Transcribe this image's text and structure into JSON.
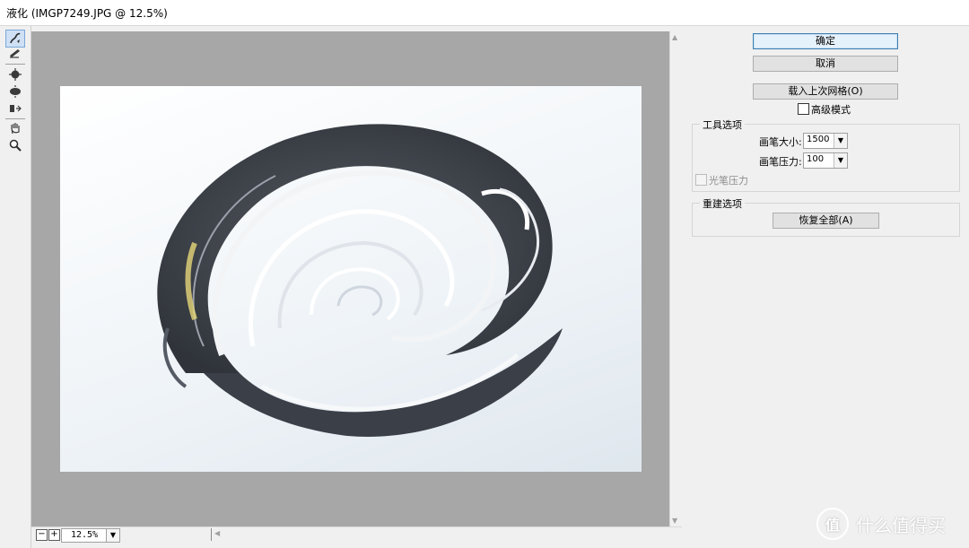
{
  "window": {
    "title": "液化 (IMGP7249.JPG @ 12.5%)"
  },
  "toolbar": {
    "tools": [
      {
        "icon": "forward-warp-icon"
      },
      {
        "icon": "reconstruct-icon"
      },
      {
        "icon": "pucker-icon"
      },
      {
        "icon": "bloat-icon"
      },
      {
        "icon": "push-left-icon"
      },
      {
        "icon": "hand-icon"
      },
      {
        "icon": "zoom-icon"
      }
    ]
  },
  "canvas": {
    "zoom_minus": "−",
    "zoom_plus": "+",
    "zoom_value": "12.5%"
  },
  "actions": {
    "ok": "确定",
    "cancel": "取消",
    "load_mesh": "载入上次网格(O)",
    "advanced_mode": "高级模式"
  },
  "tool_options": {
    "title": "工具选项",
    "brush_size_label": "画笔大小:",
    "brush_size_value": "1500",
    "brush_pressure_label": "画笔压力:",
    "brush_pressure_value": "100",
    "stylus_pressure": "光笔压力"
  },
  "reconstruct": {
    "title": "重建选项",
    "restore_all": "恢复全部(A)"
  },
  "watermark": {
    "logo": "值",
    "text": "什么值得买"
  }
}
